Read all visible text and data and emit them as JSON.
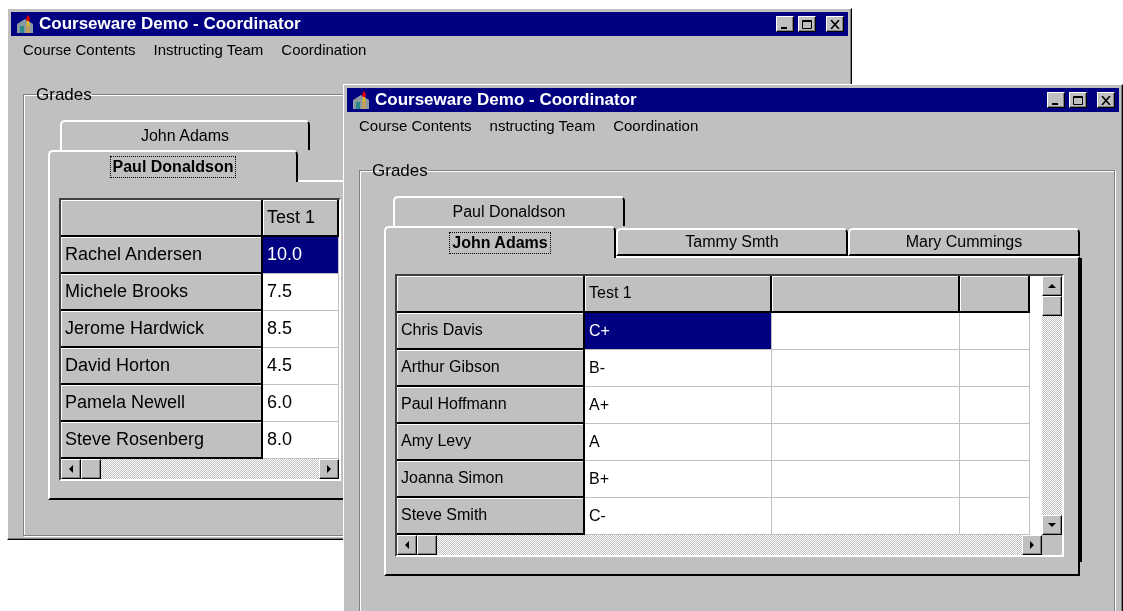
{
  "windows": [
    {
      "title": "Courseware Demo - Coordinator",
      "menu": [
        "Course Contents",
        "Instructing Team",
        "Coordination"
      ],
      "group_label": "Grades",
      "tab_rows": [
        [
          {
            "label": "John Adams",
            "selected": false
          }
        ],
        [
          {
            "label": "Paul Donaldson",
            "selected": true
          }
        ]
      ],
      "table": {
        "columns": [
          {
            "kind": "label",
            "label": "Test 1"
          }
        ],
        "rows": [
          {
            "name": "Rachel Andersen",
            "cells": [
              {
                "text": "10.0",
                "selected": true
              }
            ]
          },
          {
            "name": "Michele Brooks",
            "cells": [
              {
                "text": "7.5",
                "selected": false
              }
            ]
          },
          {
            "name": "Jerome Hardwick",
            "cells": [
              {
                "text": "8.5",
                "selected": false
              }
            ]
          },
          {
            "name": "David Horton",
            "cells": [
              {
                "text": "4.5",
                "selected": false
              }
            ]
          },
          {
            "name": "Pamela Newell",
            "cells": [
              {
                "text": "6.0",
                "selected": false
              }
            ]
          },
          {
            "name": "Steve Rosenberg",
            "cells": [
              {
                "text": "8.0",
                "selected": false
              }
            ]
          }
        ]
      }
    },
    {
      "title": "Courseware Demo - Coordinator",
      "menu": [
        "Course Contents",
        "nstructing Team",
        "Coordination"
      ],
      "group_label": "Grades",
      "tab_rows": [
        [
          {
            "label": "Paul Donaldson",
            "selected": false
          }
        ],
        [
          {
            "label": "John Adams",
            "selected": true
          },
          {
            "label": "Tammy Smth",
            "selected": false
          },
          {
            "label": "Mary Cummings",
            "selected": false
          }
        ]
      ],
      "table": {
        "columns": [
          {
            "kind": "label",
            "label": "Test 1"
          },
          {
            "kind": "blank"
          },
          {
            "kind": "blank"
          }
        ],
        "rows": [
          {
            "name": "Chris Davis",
            "cells": [
              {
                "text": "C+",
                "selected": true
              }
            ]
          },
          {
            "name": "Arthur Gibson",
            "cells": [
              {
                "text": "B-",
                "selected": false
              }
            ]
          },
          {
            "name": "Paul Hoffmann",
            "cells": [
              {
                "text": "A+",
                "selected": false
              }
            ]
          },
          {
            "name": "Amy Levy",
            "cells": [
              {
                "text": "A",
                "selected": false
              }
            ]
          },
          {
            "name": "Joanna Simon",
            "cells": [
              {
                "text": "B+",
                "selected": false
              }
            ]
          },
          {
            "name": "Steve Smith",
            "cells": [
              {
                "text": "C-",
                "selected": false
              }
            ]
          }
        ]
      }
    }
  ]
}
